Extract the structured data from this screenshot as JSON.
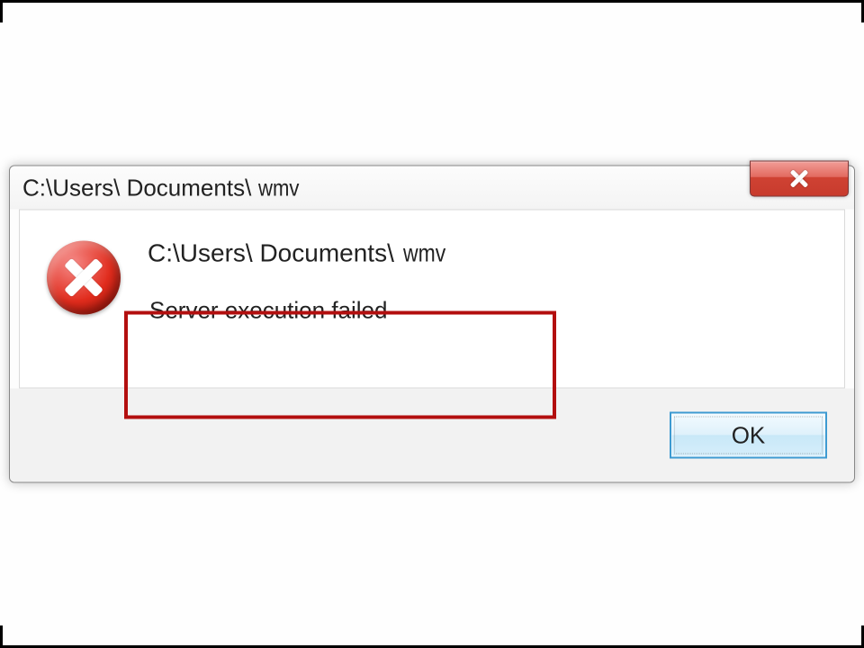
{
  "title": {
    "path": "C:\\Users\\ Documents\\",
    "ext": "wmv"
  },
  "message": {
    "path": "C:\\Users\\ Documents\\",
    "ext": "wmv",
    "error": "Server execution failed"
  },
  "buttons": {
    "ok": "OK"
  }
}
